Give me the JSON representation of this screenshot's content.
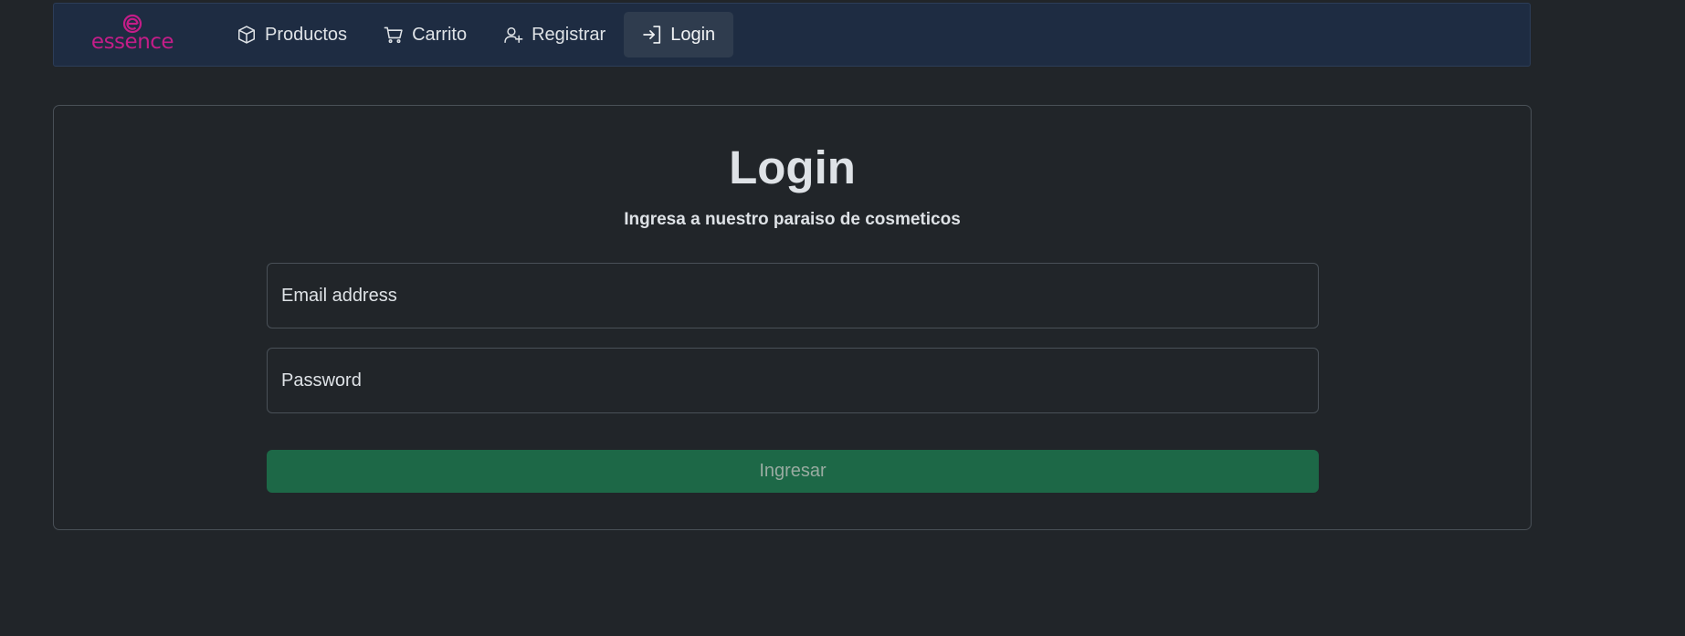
{
  "colors": {
    "background": "#212529",
    "navbar": "#1e2c42",
    "brand": "#c41d88",
    "button": "#1d6847"
  },
  "brand": {
    "name": "essence",
    "icon": "essence-logo-icon"
  },
  "nav": {
    "items": [
      {
        "label": "Productos",
        "icon": "box-icon"
      },
      {
        "label": "Carrito",
        "icon": "cart-icon"
      },
      {
        "label": "Registrar",
        "icon": "person-add-icon"
      },
      {
        "label": "Login",
        "icon": "login-icon",
        "active": true
      }
    ]
  },
  "login": {
    "title": "Login",
    "subtitle": "Ingresa a nuestro paraiso de cosmeticos",
    "email_placeholder": "Email address",
    "password_placeholder": "Password",
    "submit_label": "Ingresar"
  }
}
